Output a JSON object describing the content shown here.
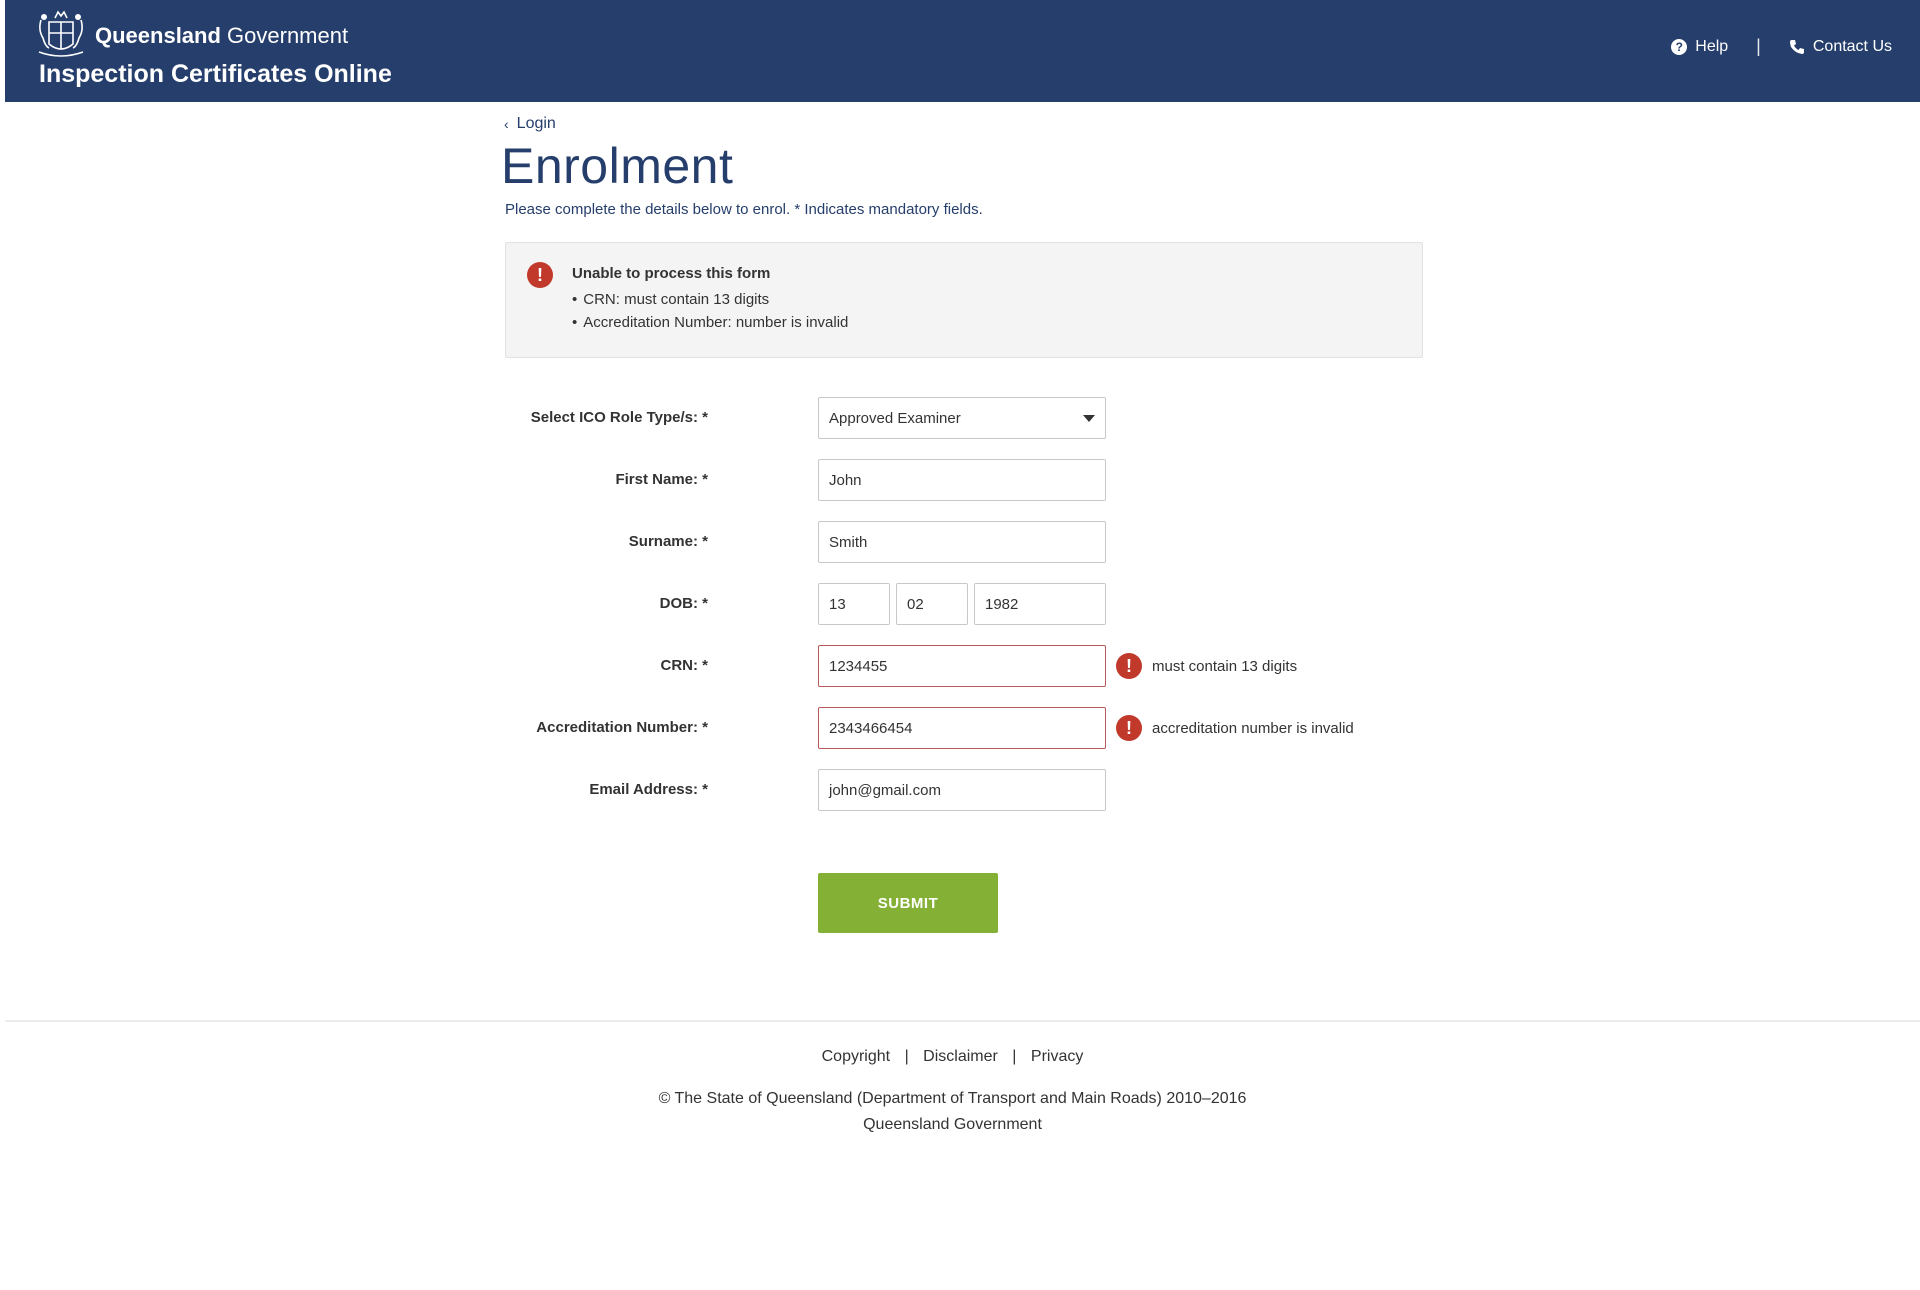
{
  "header": {
    "gov_bold": "Queensland",
    "gov_light": " Government",
    "app_title": "Inspection Certificates Online",
    "help_label": "Help",
    "contact_label": "Contact Us",
    "separator": "|"
  },
  "breadcrumb": {
    "back_label": "Login"
  },
  "page": {
    "title": "Enrolment",
    "intro": "Please complete the details below to enrol.  * Indicates mandatory fields."
  },
  "error_summary": {
    "title": "Unable to process this form",
    "items": [
      "CRN: must contain 13 digits",
      "Accreditation Number: number is invalid"
    ]
  },
  "form": {
    "role_label": "Select ICO Role Type/s: *",
    "role_value": "Approved Examiner",
    "first_name_label": "First Name: *",
    "first_name_value": "John",
    "surname_label": "Surname: *",
    "surname_value": "Smith",
    "dob_label": "DOB: *",
    "dob_day": "13",
    "dob_month": "02",
    "dob_year": "1982",
    "crn_label": "CRN: *",
    "crn_value": "1234455",
    "crn_error": "must contain 13 digits",
    "accreditation_label": "Accreditation Number: *",
    "accreditation_value": "2343466454",
    "accreditation_error": "accreditation number is invalid",
    "email_label": "Email Address: *",
    "email_value": "john@gmail.com",
    "submit_label": "SUBMIT"
  },
  "footer": {
    "copyright_link": "Copyright",
    "disclaimer_link": "Disclaimer",
    "privacy_link": "Privacy",
    "separator": "|",
    "copyright_text": "© The State of Queensland (Department of Transport and Main Roads) 2010–2016",
    "org": "Queensland Government"
  },
  "colors": {
    "header_bg": "#253e6b",
    "error_red": "#c0392b",
    "submit_green": "#84b135"
  }
}
